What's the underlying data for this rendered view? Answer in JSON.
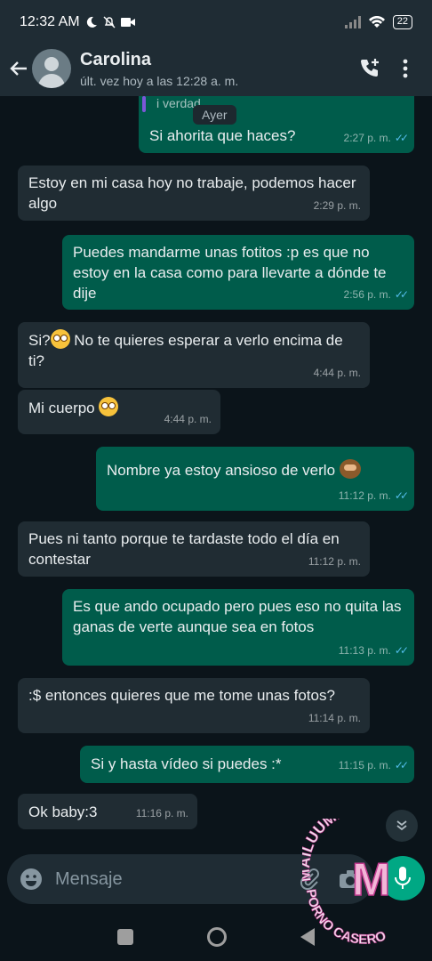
{
  "status": {
    "time": "12:32 AM",
    "battery": "22"
  },
  "header": {
    "name": "Carolina",
    "last_seen": "últ. vez hoy a las 12:28 a. m."
  },
  "quote": {
    "text": "i verdad"
  },
  "date_pill": "Ayer",
  "messages": [
    {
      "dir": "out",
      "text": "Si ahorita que haces?",
      "time": "2:27 p. m."
    },
    {
      "dir": "in",
      "text": "Estoy en mi casa hoy no trabaje, podemos hacer algo",
      "time": "2:29 p. m."
    },
    {
      "dir": "out",
      "text": "Puedes mandarme unas fotitos :p es que no estoy en la casa como para llevarte a dónde te dije",
      "time": "2:56 p. m."
    },
    {
      "dir": "in",
      "text": "Si?",
      "text2": " No te quieres esperar a verlo encima de ti?",
      "time": "4:44 p. m."
    },
    {
      "dir": "in",
      "text": "Mi cuerpo ",
      "time": "4:44 p. m."
    },
    {
      "dir": "out",
      "text": "Nombre ya estoy ansioso de verlo ",
      "time": "11:12 p. m."
    },
    {
      "dir": "in",
      "text": "Pues ni tanto porque te tardaste todo el día en contestar",
      "time": "11:12 p. m."
    },
    {
      "dir": "out",
      "text": "Es que ando ocupado pero pues eso no quita las ganas de verte aunque sea en fotos",
      "time": "11:13 p. m."
    },
    {
      "dir": "in",
      "text": ":$ entonces quieres que me tome unas fotos?",
      "time": "11:14 p. m."
    },
    {
      "dir": "out",
      "text": "Si y hasta vídeo si puedes :*",
      "time": "11:15 p. m."
    },
    {
      "dir": "in",
      "text": "Ok baby:3",
      "time": "11:16 p. m."
    }
  ],
  "input": {
    "placeholder": "Mensaje"
  },
  "watermark": {
    "top": "MAILUUME",
    "letter": "M",
    "bottom": "PORNO CASERO"
  },
  "colors": {
    "incoming": "#202c33",
    "outgoing": "#005c4b",
    "read_ticks": "#53bdeb",
    "mic": "#00a884"
  }
}
